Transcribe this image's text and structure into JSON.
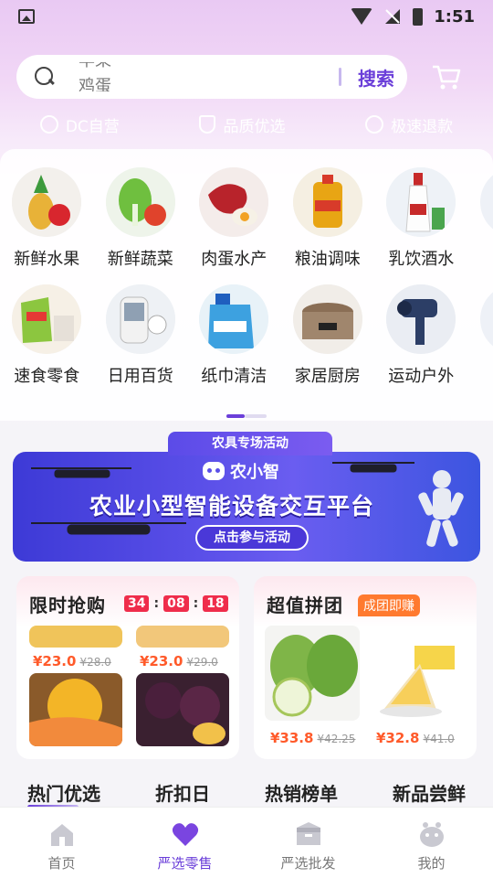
{
  "status_bar": {
    "time": "1:51"
  },
  "search": {
    "placeholder_line1": "苹果",
    "placeholder_line2": "鸡蛋",
    "button_label": "搜索"
  },
  "services": [
    {
      "label": "DC自营",
      "icon": "store-icon"
    },
    {
      "label": "品质优选",
      "icon": "shield-check-icon"
    },
    {
      "label": "极速退款",
      "icon": "refund-icon"
    }
  ],
  "categories": {
    "row1": [
      {
        "label": "新鲜水果",
        "icon": "fruit-icon"
      },
      {
        "label": "新鲜蔬菜",
        "icon": "vegetable-icon"
      },
      {
        "label": "肉蛋水产",
        "icon": "meat-egg-icon"
      },
      {
        "label": "粮油调味",
        "icon": "oil-grain-icon"
      },
      {
        "label": "乳饮酒水",
        "icon": "drinks-icon"
      },
      {
        "label": "个",
        "icon": "personal-care-icon"
      }
    ],
    "row2": [
      {
        "label": "速食零食",
        "icon": "snack-icon"
      },
      {
        "label": "日用百货",
        "icon": "daily-goods-icon"
      },
      {
        "label": "纸巾清洁",
        "icon": "cleaning-icon"
      },
      {
        "label": "家居厨房",
        "icon": "kitchen-icon"
      },
      {
        "label": "运动户外",
        "icon": "sports-icon"
      },
      {
        "label": "滋",
        "icon": "health-icon"
      }
    ]
  },
  "banner": {
    "tag": "农具专场活动",
    "logo_text": "农小智",
    "title": "农业小型智能设备交互平台",
    "cta": "点击参与活动"
  },
  "flash_sale": {
    "title": "限时抢购",
    "countdown": {
      "h": "34",
      "m": "08",
      "s": "18"
    },
    "items": [
      {
        "price": "¥23.0",
        "old_price": "¥28.0"
      },
      {
        "price": "¥23.0",
        "old_price": "¥29.0"
      }
    ]
  },
  "group_buy": {
    "title": "超值拼团",
    "badge": "成团即赚",
    "items": [
      {
        "price": "¥33.8",
        "old_price": "¥42.25"
      },
      {
        "price": "¥32.8",
        "old_price": "¥41.0"
      }
    ]
  },
  "section_tabs": [
    {
      "label": "热门优选",
      "active": true
    },
    {
      "label": "折扣日",
      "active": false
    },
    {
      "label": "热销榜单",
      "active": false
    },
    {
      "label": "新品尝鲜",
      "active": false
    }
  ],
  "bottom_nav": [
    {
      "label": "首页",
      "icon": "home-icon"
    },
    {
      "label": "严选零售",
      "icon": "heart-icon"
    },
    {
      "label": "严选批发",
      "icon": "box-icon"
    },
    {
      "label": "我的",
      "icon": "profile-icon"
    }
  ],
  "colors": {
    "accent": "#6b3fd9",
    "price": "#ff5a2a",
    "countdown": "#ef2d4b",
    "badge": "#ff7a2f"
  }
}
